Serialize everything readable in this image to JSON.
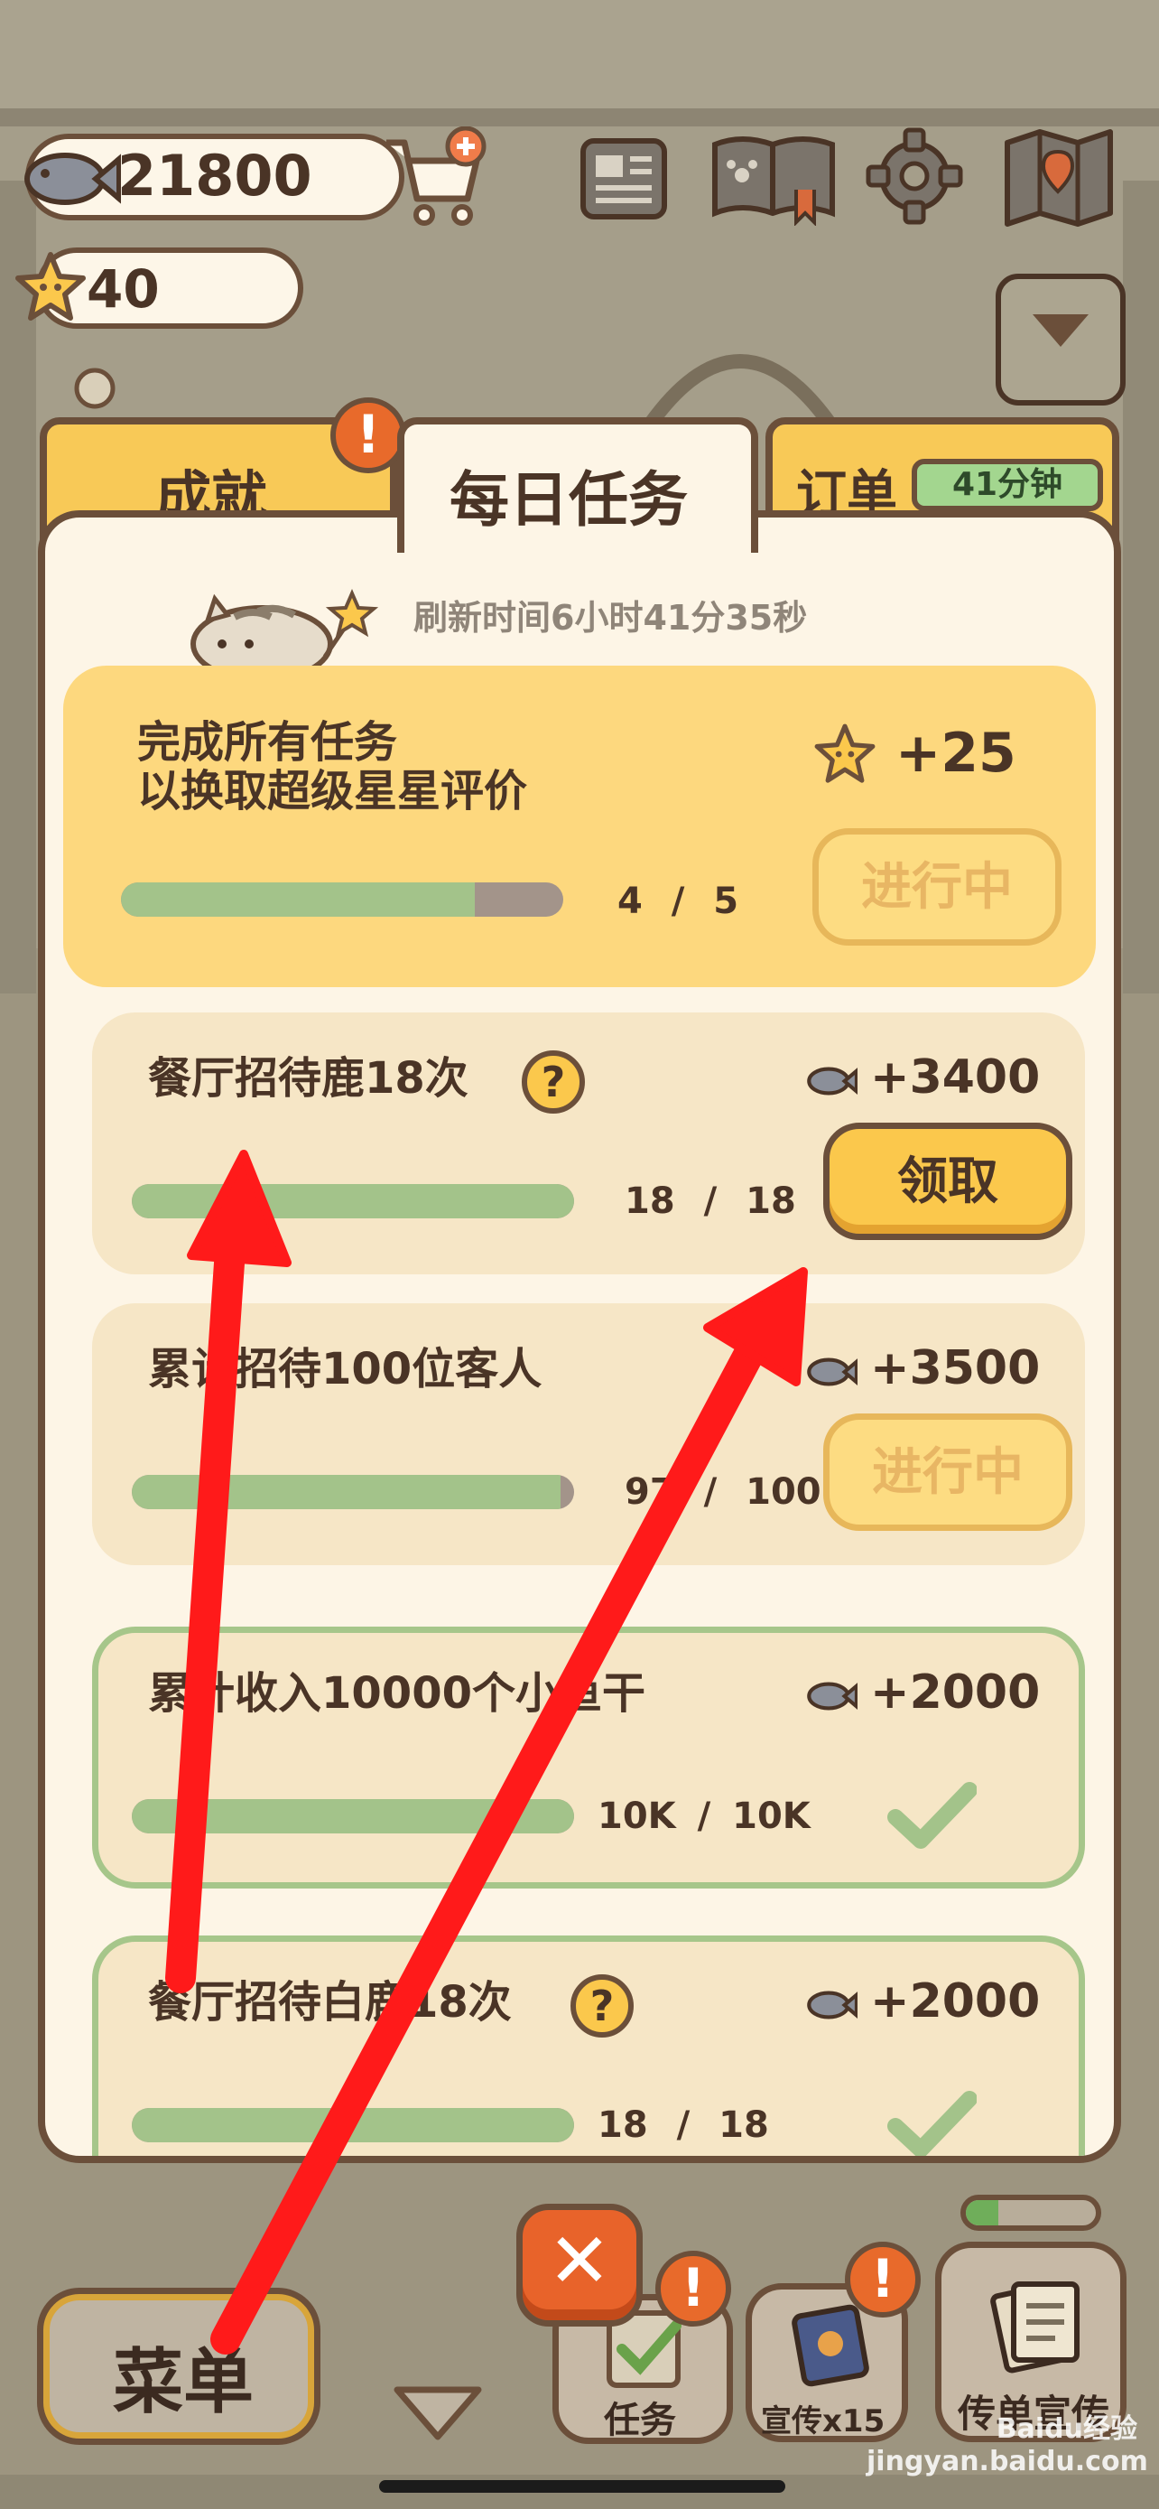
{
  "hud": {
    "fish_count": "21800",
    "star_count": "40"
  },
  "tabs": {
    "achievements": "成就",
    "daily": "每日任务",
    "orders": "订单",
    "orders_timer": "41分钟"
  },
  "refresh_text": "刷新时间6小时41分35秒",
  "tasks": [
    {
      "title_line1": "完成所有任务",
      "title_line2": "以换取超级星星评价",
      "reward": "+25",
      "reward_icon": "star-icon",
      "progress_text": "4 / 5",
      "progress": 0.8,
      "status": "进行中"
    },
    {
      "title": "餐厅招待鹿18次",
      "has_help": true,
      "reward": "+3400",
      "reward_icon": "fish-icon",
      "progress_text": "18 / 18",
      "progress": 1.0,
      "status": "领取"
    },
    {
      "title": "累计招待100位客人",
      "reward": "+3500",
      "reward_icon": "fish-icon",
      "progress_text": "97 / 100",
      "progress": 0.97,
      "status": "进行中"
    },
    {
      "title": "累计收入10000个小鱼干",
      "reward": "+2000",
      "reward_icon": "fish-icon",
      "progress_text": "10K / 10K",
      "progress": 1.0,
      "status": "done",
      "status_icon": "checkmark-icon"
    },
    {
      "title": "餐厅招待白鹿18次",
      "has_help": true,
      "reward": "+2000",
      "reward_icon": "fish-icon",
      "progress_text": "18 / 18",
      "progress": 1.0,
      "status": "done",
      "status_icon": "checkmark-icon"
    }
  ],
  "help_symbol": "?",
  "alert_symbol": "!",
  "close_symbol": "✕",
  "bottom": {
    "menu": "菜单",
    "tasks": "任务",
    "promo": "宣传x15",
    "flyer": "传单宣传"
  },
  "watermark": "Baidu经验 jingyan.baidu.com",
  "colors": {
    "frame_brown": "#6b4f3a",
    "panel_cream": "#fdf5e6",
    "tab_yellow": "#f8c957",
    "progress_green": "#a3c38a",
    "done_border_green": "#a6c68a",
    "alert_orange": "#e86a2b",
    "arrow_red": "#ff1a1a"
  }
}
